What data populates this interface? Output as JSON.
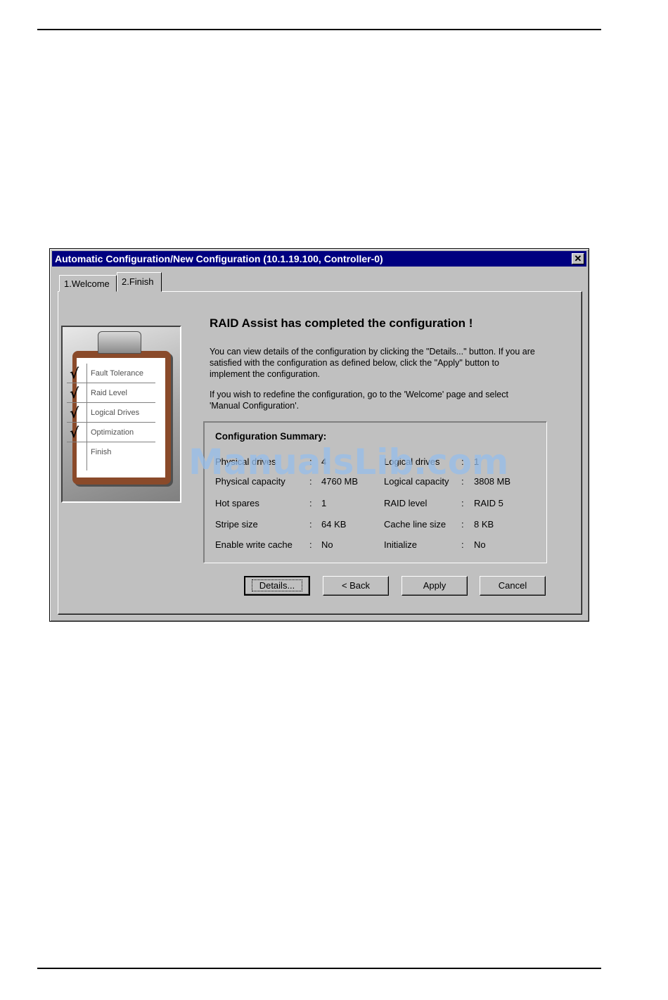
{
  "window": {
    "title": "Automatic Configuration/New Configuration (10.1.19.100, Controller-0)",
    "close_glyph": "✕"
  },
  "tabs": [
    {
      "label": "1.Welcome",
      "selected": false
    },
    {
      "label": "2.Finish",
      "selected": true
    }
  ],
  "checklist": [
    {
      "label": "Fault Tolerance",
      "checked": true
    },
    {
      "label": "Raid Level",
      "checked": true
    },
    {
      "label": "Logical Drives",
      "checked": true
    },
    {
      "label": "Optimization",
      "checked": true
    },
    {
      "label": "Finish",
      "checked": false
    }
  ],
  "check_glyph": "√",
  "heading": "RAID Assist has completed the configuration !",
  "paragraph1": "You can view details of the configuration by clicking the \"Details...\" button. If you are satisfied with the configuration as defined below, click the \"Apply\" button to implement the configuration.",
  "paragraph2": "If you wish to redefine the configuration, go to the 'Welcome' page and select 'Manual Configuration'.",
  "summary": {
    "title": "Configuration Summary:",
    "separator": ":",
    "rows": [
      {
        "left_label": "Physical drives",
        "left_value": "4",
        "right_label": "Logical drives",
        "right_value": "1"
      },
      {
        "left_label": "Physical capacity",
        "left_value": "4760 MB",
        "right_label": "Logical capacity",
        "right_value": "3808 MB"
      },
      {
        "left_label": "Hot spares",
        "left_value": "1",
        "right_label": "RAID level",
        "right_value": "RAID 5"
      },
      {
        "left_label": "Stripe size",
        "left_value": "64 KB",
        "right_label": "Cache line size",
        "right_value": "8 KB"
      },
      {
        "left_label": "Enable write cache",
        "left_value": "No",
        "right_label": "Initialize",
        "right_value": "No"
      }
    ]
  },
  "buttons": {
    "details": "Details...",
    "back": "< Back",
    "apply": "Apply",
    "cancel": "Cancel"
  },
  "watermark": "ManualsLib.com",
  "colors": {
    "titlebar": "#000080",
    "dialog_face": "#c0c0c0",
    "clipboard": "#8a4a2a",
    "watermark": "#96bee b"
  }
}
